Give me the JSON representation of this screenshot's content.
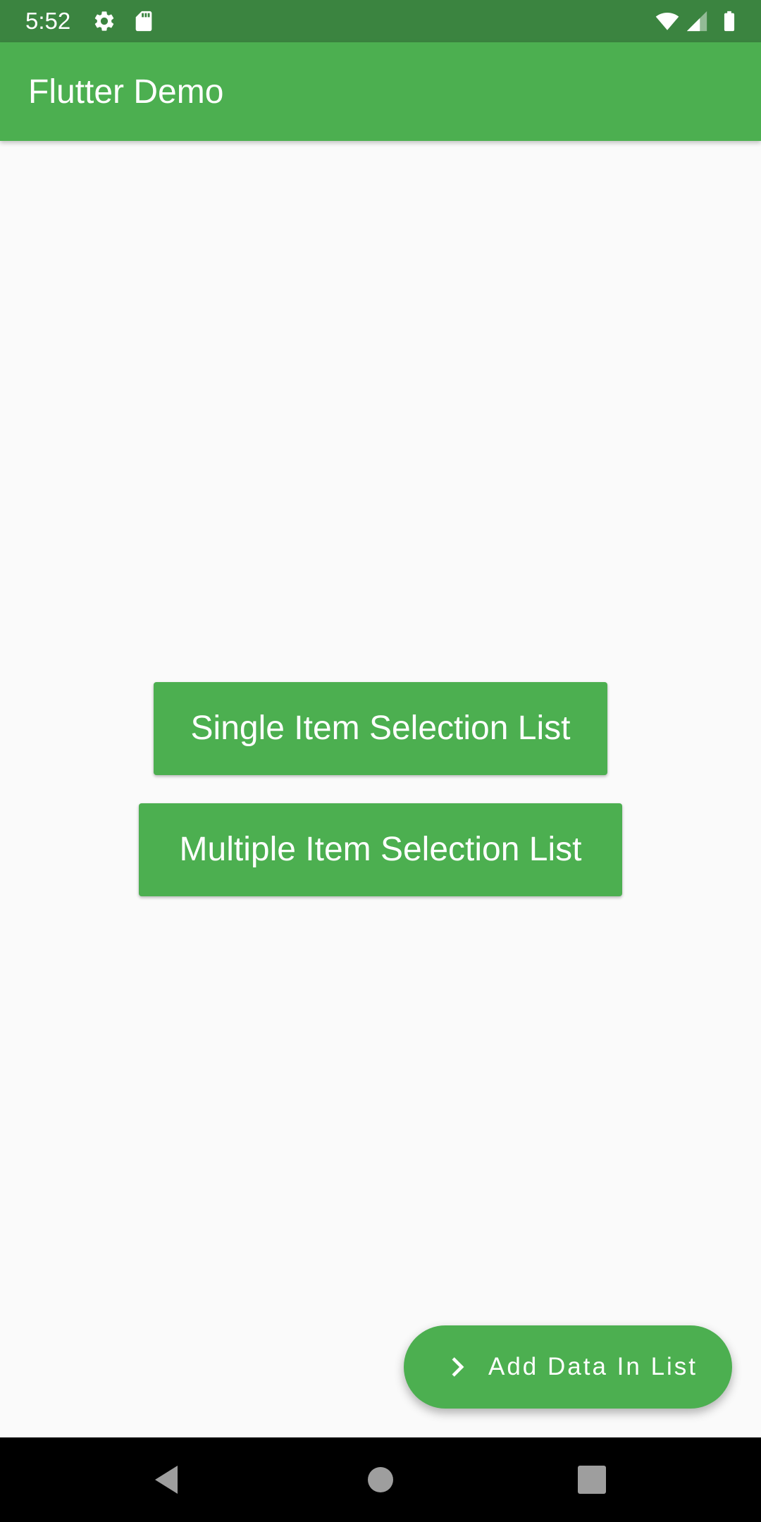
{
  "status_bar": {
    "time": "5:52",
    "icons": [
      "gear-icon",
      "sd-card-icon",
      "wifi-icon",
      "cell-signal-icon",
      "battery-icon"
    ]
  },
  "app_bar": {
    "title": "Flutter Demo"
  },
  "main": {
    "buttons": [
      {
        "label": "Single Item Selection List"
      },
      {
        "label": "Multiple Item Selection List"
      }
    ]
  },
  "fab": {
    "label": "Add Data In List",
    "icon": "chevron-right-icon"
  },
  "nav_bar": {
    "icons": [
      "back-icon",
      "home-icon",
      "recents-icon"
    ]
  },
  "colors": {
    "primary": "#4caf50",
    "status_bar": "#3b8440",
    "background": "#fafafa"
  }
}
